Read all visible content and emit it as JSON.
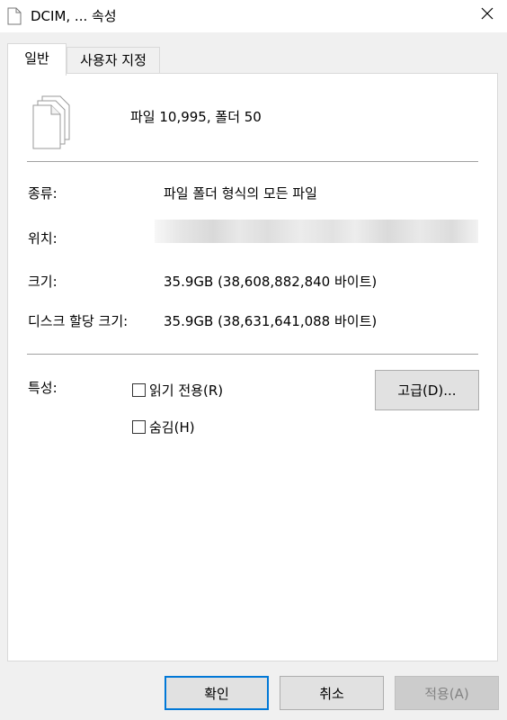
{
  "window": {
    "title": "DCIM, ... 속성",
    "icon": "document-icon",
    "close_icon": "close-icon"
  },
  "tabs": [
    {
      "label": "일반",
      "active": true
    },
    {
      "label": "사용자 지정",
      "active": false
    }
  ],
  "general": {
    "summary": "파일 10,995, 폴더 50",
    "rows": [
      {
        "label": "종류:",
        "value": "파일 폴더 형식의 모든 파일"
      },
      {
        "label": "위치:",
        "value": ""
      },
      {
        "label": "크기:",
        "value": "35.9GB (38,608,882,840 바이트)"
      },
      {
        "label": "디스크 할당 크기:",
        "value": "35.9GB (38,631,641,088 바이트)"
      }
    ],
    "attributes": {
      "label": "특성:",
      "readonly_label": "읽기 전용(R)",
      "readonly_checked": false,
      "hidden_label": "숨김(H)",
      "hidden_checked": false,
      "advanced_button": "고급(D)..."
    }
  },
  "buttons": {
    "ok": "확인",
    "cancel": "취소",
    "apply": "적용(A)",
    "apply_enabled": false
  }
}
